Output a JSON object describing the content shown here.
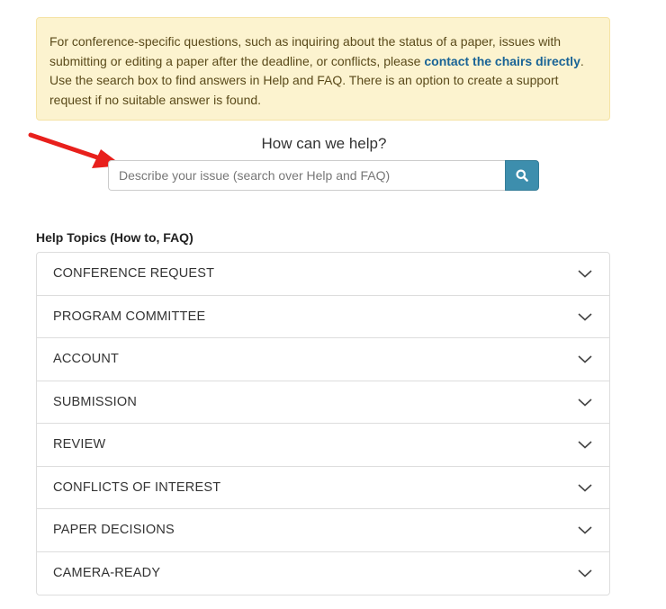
{
  "notice": {
    "text_before": "For conference-specific questions, such as inquiring about the status of a paper, issues with submitting or editing a paper after the deadline, or conflicts, please ",
    "link": "contact the chairs directly",
    "text_after": ". Use the search box to find answers in Help and FAQ. There is an option to create a support request if no suitable answer is found."
  },
  "help": {
    "title": "How can we help?"
  },
  "search": {
    "placeholder": "Describe your issue (search over Help and FAQ)",
    "icon": "search-icon"
  },
  "topics": {
    "heading": "Help Topics (How to, FAQ)",
    "items": [
      {
        "label": "CONFERENCE REQUEST"
      },
      {
        "label": "PROGRAM COMMITTEE"
      },
      {
        "label": "ACCOUNT"
      },
      {
        "label": "SUBMISSION"
      },
      {
        "label": "REVIEW"
      },
      {
        "label": "CONFLICTS OF INTEREST"
      },
      {
        "label": "PAPER DECISIONS"
      },
      {
        "label": "CAMERA-READY"
      }
    ]
  },
  "colors": {
    "notice_bg": "#fcf3cf",
    "link": "#1a6496",
    "search_button": "#3d8ead",
    "annotation_arrow": "#e8201c"
  }
}
